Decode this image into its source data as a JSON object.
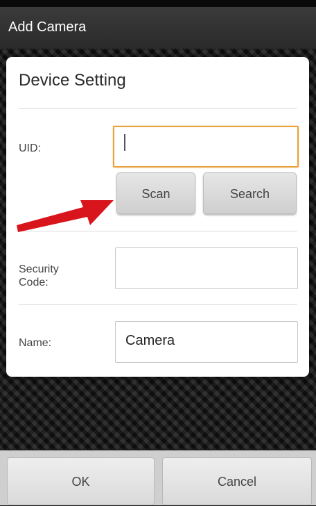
{
  "app_bar": {
    "title": "Add Camera"
  },
  "dialog": {
    "title": "Device Setting",
    "uid": {
      "label": "UID:",
      "value": ""
    },
    "scan_button": "Scan",
    "search_button": "Search",
    "security_code": {
      "label_line1": "Security",
      "label_line2": "Code:",
      "value": ""
    },
    "name": {
      "label": "Name:",
      "value": "Camera"
    }
  },
  "footer": {
    "ok": "OK",
    "cancel": "Cancel"
  },
  "annotation": {
    "arrow_color": "#d8141c"
  }
}
